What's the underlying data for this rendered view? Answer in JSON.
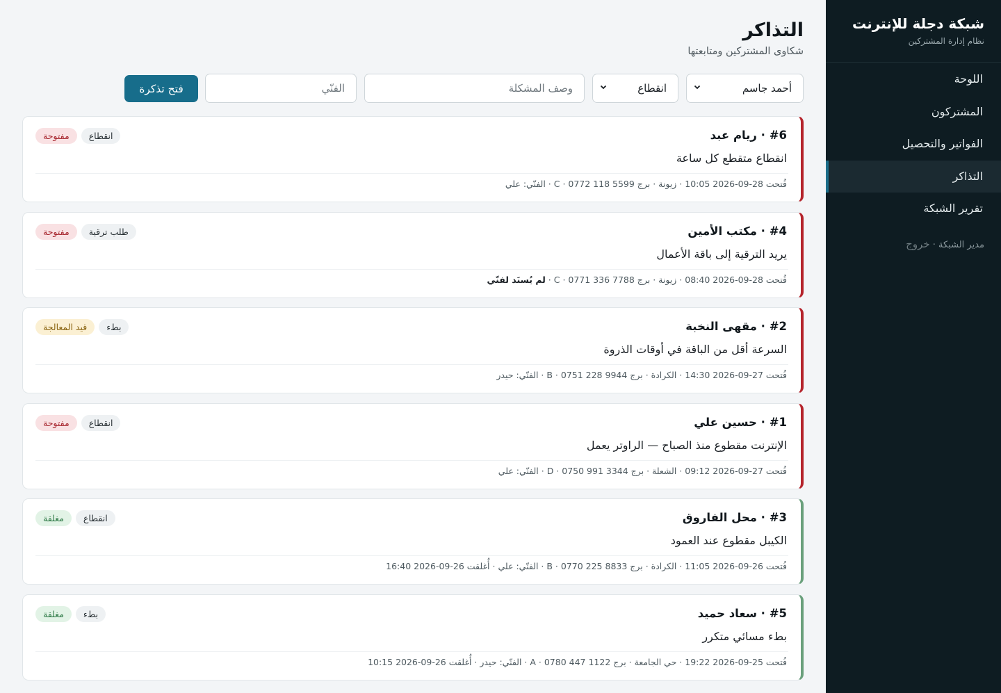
{
  "sidebar": {
    "brand_title": "شبكة دجلة للإنترنت",
    "brand_sub": "نظام إدارة المشتركين",
    "items": [
      {
        "label": "اللوحة"
      },
      {
        "label": "المشتركون"
      },
      {
        "label": "الفواتير والتحصيل"
      },
      {
        "label": "التذاكر"
      },
      {
        "label": "تقرير الشبكة"
      }
    ],
    "footer_user": "مدير الشبكة ·",
    "footer_logout": "خروج"
  },
  "page": {
    "title": "التذاكر",
    "subtitle": "شكاوى المشتركين ومتابعتها"
  },
  "filters": {
    "subscriber_value": "أحمد جاسم",
    "category_value": "انقطاع",
    "description_placeholder": "وصف المشكلة",
    "technician_placeholder": "الفنّي",
    "open_button": "فتح تذكرة"
  },
  "tickets": [
    {
      "head": "#6 · ريام عبد",
      "desc": "انقطاع متقطع كل ساعة",
      "meta": "فُتحت 28-09-2026 10:05 · زيونة · برج C · 0772 118 5599 · الفنّي: علي",
      "meta_strong": "",
      "status": "مفتوحة",
      "category": "انقطاع"
    },
    {
      "head": "#4 · مكتب الأمين",
      "desc": "يريد الترقية إلى باقة الأعمال",
      "meta": "فُتحت 28-09-2026 08:40 · زيونة · برج C · 0771 336 7788 · ",
      "meta_strong": "لم يُسنَد لفنّي",
      "status": "مفتوحة",
      "category": "طلب ترقية"
    },
    {
      "head": "#2 · مقهى النخبة",
      "desc": "السرعة أقل من الباقة في أوقات الذروة",
      "meta": "فُتحت 27-09-2026 14:30 · الكرادة · برج B · 0751 228 9944 · الفنّي: حيدر",
      "meta_strong": "",
      "status": "قيد المعالجة",
      "category": "بطء"
    },
    {
      "head": "#1 · حسين علي",
      "desc": "الإنترنت مقطوع منذ الصباح — الراوتر يعمل",
      "meta": "فُتحت 27-09-2026 09:12 · الشعلة · برج D · 0750 991 3344 · الفنّي: علي",
      "meta_strong": "",
      "status": "مفتوحة",
      "category": "انقطاع"
    },
    {
      "head": "#3 · محل الفاروق",
      "desc": "الكيبل مقطوع عند العمود",
      "meta": "فُتحت 26-09-2026 11:05 · الكرادة · برج B · 0770 225 8833 · الفنّي: علي · أُغلقت 26-09-2026 16:40",
      "meta_strong": "",
      "status": "مغلقة",
      "category": "انقطاع"
    },
    {
      "head": "#5 · سعاد حميد",
      "desc": "بطء مسائي متكرر",
      "meta": "فُتحت 25-09-2026 19:22 · حي الجامعة · برج A · 0780 447 1122 · الفنّي: حيدر · أُغلقت 26-09-2026 10:15",
      "meta_strong": "",
      "status": "مغلقة",
      "category": "بطء"
    }
  ],
  "colors": {
    "sidebar_bg": "#0e1c22",
    "primary": "#176d8b",
    "open_border": "#b5242c",
    "closed_border": "#6aa07c"
  }
}
